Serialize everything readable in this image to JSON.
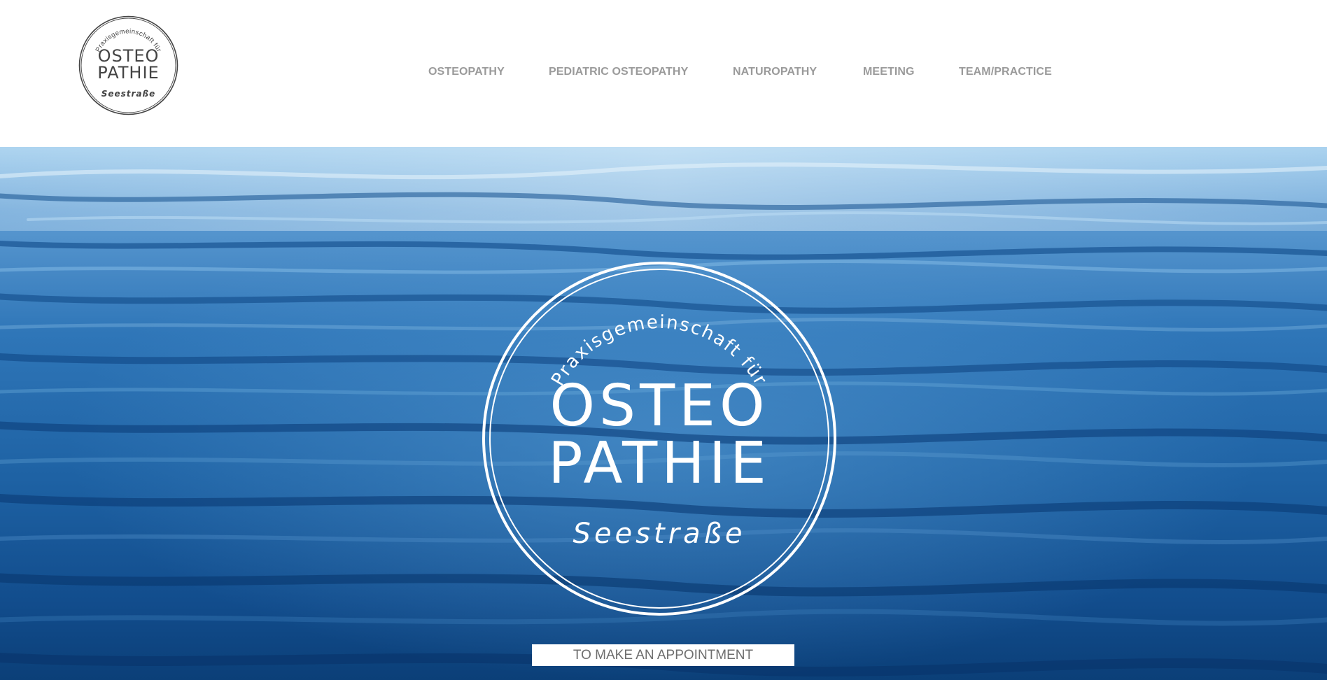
{
  "header": {
    "logo": {
      "arc_text": "Praxisgemeinschaft für",
      "line1": "OSTEO",
      "line2": "PATHIE",
      "subtitle": "Seestraße"
    },
    "nav": [
      {
        "label": "OSTEOPATHY"
      },
      {
        "label": "PEDIATRIC OSTEOPATHY"
      },
      {
        "label": "NATUROPATHY"
      },
      {
        "label": "MEETING"
      },
      {
        "label": "TEAM/PRACTICE"
      }
    ]
  },
  "hero": {
    "logo": {
      "arc_text": "Praxisgemeinschaft für",
      "line1": "OSTEO",
      "line2": "PATHIE",
      "subtitle": "Seestraße"
    },
    "cta_label": "TO MAKE AN APPOINTMENT"
  },
  "colors": {
    "nav_text": "#9a9a9a",
    "logo_stroke": "#444444",
    "water_dark": "#0e4a86",
    "water_light": "#8cc3ea",
    "cta_text": "#6e6e6e"
  },
  "icons": {
    "hero_background": "water-surface-image"
  }
}
